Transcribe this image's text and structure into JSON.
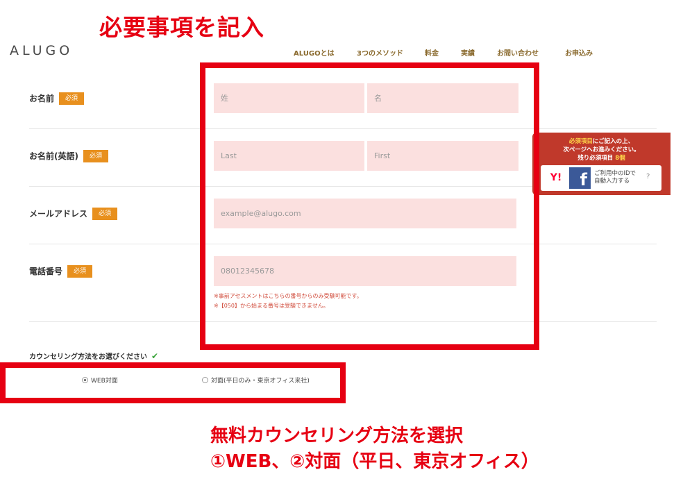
{
  "annotations": {
    "title": "必要事項を記入",
    "counsel_line1": "無料カウンセリング方法を選択",
    "counsel_line2": "①WEB、②対面（平日、東京オフィス）"
  },
  "header": {
    "logo": "ALUGO",
    "nav": [
      "ALUGOとは",
      "3つのメソッド",
      "料金",
      "実績",
      "お問い合わせ",
      "お申込み"
    ]
  },
  "form": {
    "required_badge": "必須",
    "name": {
      "label": "お名前",
      "last_placeholder": "姓",
      "first_placeholder": "名"
    },
    "name_en": {
      "label": "お名前(英語)",
      "last_placeholder": "Last",
      "first_placeholder": "First"
    },
    "email": {
      "label": "メールアドレス",
      "placeholder": "example@alugo.com"
    },
    "phone": {
      "label": "電話番号",
      "placeholder": "08012345678",
      "note1": "※事前アセスメントはこちらの番号からのみ受験可能です。",
      "note2": "※【050】から始まる番号は受験できません。"
    },
    "counseling": {
      "label": "カウンセリング方法をお選びください",
      "options": [
        "WEB対面",
        "対面(平日のみ・東京オフィス来社)"
      ],
      "selected": "WEB対面"
    }
  },
  "widget": {
    "line1_highlight": "必須項目",
    "line1_rest": "にご記入の上、",
    "line2": "次ページへお進みください。",
    "line3_prefix": "残り必須項目",
    "line3_count": "8個",
    "yahoo_mark": "Y!",
    "facebook_mark": "f",
    "id_text_line1": "ご利用中のIDで",
    "id_text_line2": "自動入力する",
    "help": "?"
  },
  "colors": {
    "annotation_red": "#e60012",
    "badge_orange": "#e8901e",
    "field_pink": "#fbe0df",
    "widget_red": "#c0392b",
    "facebook_blue": "#3b5998"
  }
}
